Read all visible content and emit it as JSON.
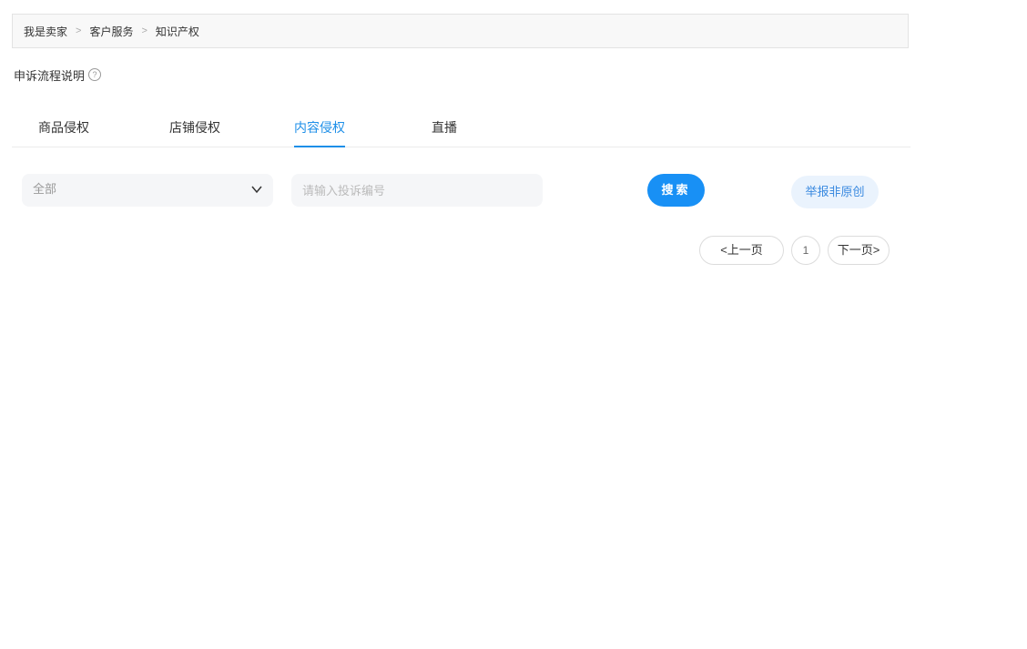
{
  "breadcrumb": {
    "items": [
      "我是卖家",
      "客户服务",
      "知识产权"
    ],
    "separator": ">"
  },
  "help": {
    "label": "申诉流程说明",
    "icon": "question-circle-icon",
    "icon_glyph": "?"
  },
  "tabs": [
    {
      "label": "商品侵权",
      "active": false
    },
    {
      "label": "店铺侵权",
      "active": false
    },
    {
      "label": "内容侵权",
      "active": true
    },
    {
      "label": "直播",
      "active": false
    }
  ],
  "filter": {
    "select_value": "全部",
    "select_icon": "chevron-down-icon",
    "input_placeholder": "请输入投诉编号",
    "input_value": ""
  },
  "buttons": {
    "search_label": "搜索",
    "report_label": "举报非原创"
  },
  "pagination": {
    "prev_label": "<上一页",
    "current_page": "1",
    "next_label": "下一页>"
  },
  "colors": {
    "accent": "#1890f5",
    "active_tab": "#1e8fe8",
    "report_bg": "#eaf3fd",
    "report_text": "#3a8ae0"
  }
}
